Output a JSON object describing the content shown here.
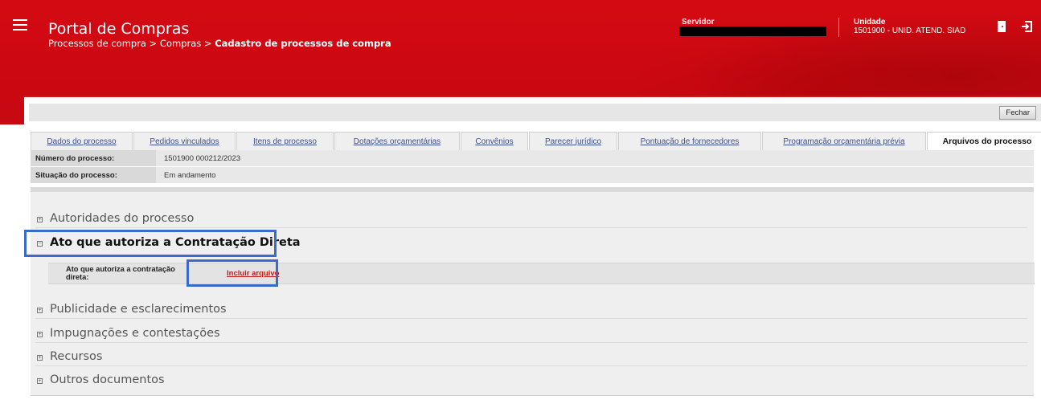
{
  "header": {
    "app_title": "Portal de Compras",
    "breadcrumb_prefix": "Processos de compra > Compras > ",
    "breadcrumb_current": "Cadastro de processos de compra",
    "servidor_label": "Servidor",
    "unidade_label": "Unidade",
    "unidade_value": "1501900 - UNID. ATEND. SIAD"
  },
  "toolbar": {
    "close_label": "Fechar"
  },
  "tabs": [
    {
      "label": "Dados do processo",
      "active": false
    },
    {
      "label": "Pedidos vinculados",
      "active": false
    },
    {
      "label": "Itens de processo",
      "active": false
    },
    {
      "label": "Dotações orçamentárias",
      "active": false
    },
    {
      "label": "Convênios",
      "active": false
    },
    {
      "label": "Parecer jurídico",
      "active": false
    },
    {
      "label": "Pontuação de fornecedores",
      "active": false
    },
    {
      "label": "Programação orçamentária prévia",
      "active": false
    },
    {
      "label": "Arquivos do processo",
      "active": true
    }
  ],
  "info": {
    "numero_label": "Número do processo:",
    "numero_value": "1501900 000212/2023",
    "situacao_label": "Situação do processo:",
    "situacao_value": "Em andamento"
  },
  "sections": [
    {
      "label": "Autoridades do processo",
      "open": false
    },
    {
      "label": "Ato que autoriza a Contratação Direta",
      "open": true
    },
    {
      "label": "Publicidade e esclarecimentos",
      "open": false
    },
    {
      "label": "Impugnações e contestações",
      "open": false
    },
    {
      "label": "Recursos",
      "open": false
    },
    {
      "label": "Outros documentos",
      "open": false
    }
  ],
  "ato": {
    "field_label": "Ato que autoriza a contratação direta:",
    "link_label": "Incluir arquivo"
  },
  "colors": {
    "brand_red": "#d40a12",
    "highlight_blue": "#3a6bc9"
  },
  "icons": {
    "menu": "hamburger-icon",
    "door": "door-icon",
    "logout": "logout-icon",
    "plus": "plus-box-icon",
    "minus": "minus-box-icon"
  }
}
